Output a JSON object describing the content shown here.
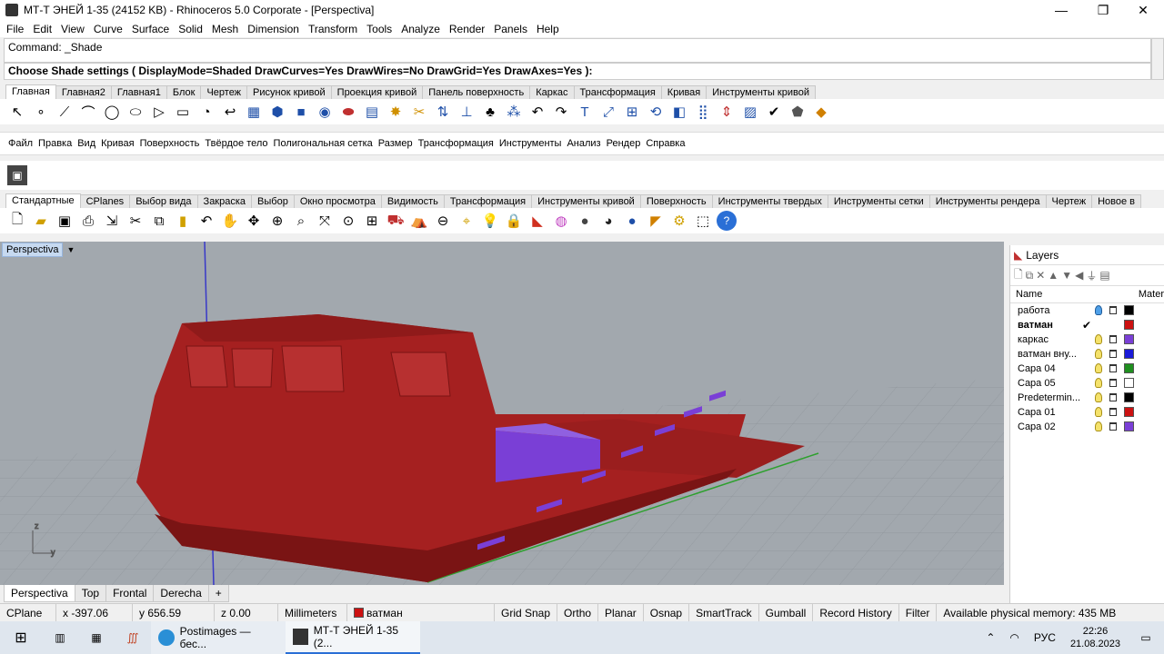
{
  "window": {
    "title": "МТ-Т ЭНЕЙ 1-35 (24152 KB) - Rhinoceros  5.0 Corporate - [Perspectiva]",
    "minimize": "—",
    "restore": "❐",
    "close": "✕"
  },
  "menu": [
    "File",
    "Edit",
    "View",
    "Curve",
    "Surface",
    "Solid",
    "Mesh",
    "Dimension",
    "Transform",
    "Tools",
    "Analyze",
    "Render",
    "Panels",
    "Help"
  ],
  "command": {
    "history": "Command: _Shade",
    "prompt": "Choose Shade settings ( DisplayMode=Shaded  DrawCurves=Yes  DrawWires=No  DrawGrid=Yes  DrawAxes=Yes ):"
  },
  "tabs_top": [
    "Главная",
    "Главная2",
    "Главная1",
    "Блок",
    "Чертеж",
    "Рисунок кривой",
    "Проекция кривой",
    "Панель поверхность",
    "Каркас",
    "Трансформация",
    "Кривая",
    "Инструменты кривой"
  ],
  "russian_menu": [
    "Файл",
    "Правка",
    "Вид",
    "Кривая",
    "Поверхность",
    "Твёрдое тело",
    "Полигональная сетка",
    "Размер",
    "Трансформация",
    "Инструменты",
    "Анализ",
    "Рендер",
    "Справка"
  ],
  "tabs_std": [
    "Стандартные",
    "CPlanes",
    "Выбор вида",
    "Закраска",
    "Выбор",
    "Окно просмотра",
    "Видимость",
    "Трансформация",
    "Инструменты кривой",
    "Поверхность",
    "Инструменты твердых",
    "Инструменты сетки",
    "Инструменты рендера",
    "Чертеж",
    "Новое в"
  ],
  "viewport": {
    "name": "Perspectiva",
    "dropdown": "▼"
  },
  "viewport_tabs": [
    "Perspectiva",
    "Top",
    "Frontal",
    "Derecha",
    "+"
  ],
  "layers": {
    "title": "Layers",
    "col_name": "Name",
    "col_material": "Mater",
    "rows": [
      {
        "name": "работа",
        "bulb": "blue",
        "color": "#000000",
        "current": false
      },
      {
        "name": "ватман",
        "bulb": "none",
        "color": "#cc1111",
        "current": true
      },
      {
        "name": "каркас",
        "bulb": "yellow",
        "color": "#7a3fd6",
        "current": false
      },
      {
        "name": "ватман вну...",
        "bulb": "yellow",
        "color": "#1a1ad8",
        "current": false
      },
      {
        "name": "Capa 04",
        "bulb": "yellow",
        "color": "#1f8f1f",
        "current": false
      },
      {
        "name": "Capa 05",
        "bulb": "yellow",
        "color": "#ffffff",
        "current": false
      },
      {
        "name": "Predetermin...",
        "bulb": "yellow",
        "color": "#000000",
        "current": false
      },
      {
        "name": "Capa 01",
        "bulb": "yellow",
        "color": "#cc1111",
        "current": false
      },
      {
        "name": "Capa 02",
        "bulb": "yellow",
        "color": "#7a3fd6",
        "current": false
      }
    ]
  },
  "status": {
    "cplane": "CPlane",
    "x": "x -397.06",
    "y": "y 656.59",
    "z": "z 0.00",
    "units": "Millimeters",
    "layer": "ватман",
    "toggles": [
      "Grid Snap",
      "Ortho",
      "Planar",
      "Osnap",
      "SmartTrack",
      "Gumball",
      "Record History",
      "Filter"
    ],
    "memory": "Available physical memory: 435 MB"
  },
  "taskbar": {
    "app1": "Postimages — бес...",
    "app2": "МТ-Т ЭНЕЙ 1-35 (2...",
    "lang": "РУС",
    "time": "22:26",
    "date": "21.08.2023"
  },
  "colors": {
    "viewport_bg": "#a2a8ae",
    "model_red": "#a52020",
    "model_purple": "#7a3fd6",
    "accent_blue": "#1e4fa8"
  }
}
